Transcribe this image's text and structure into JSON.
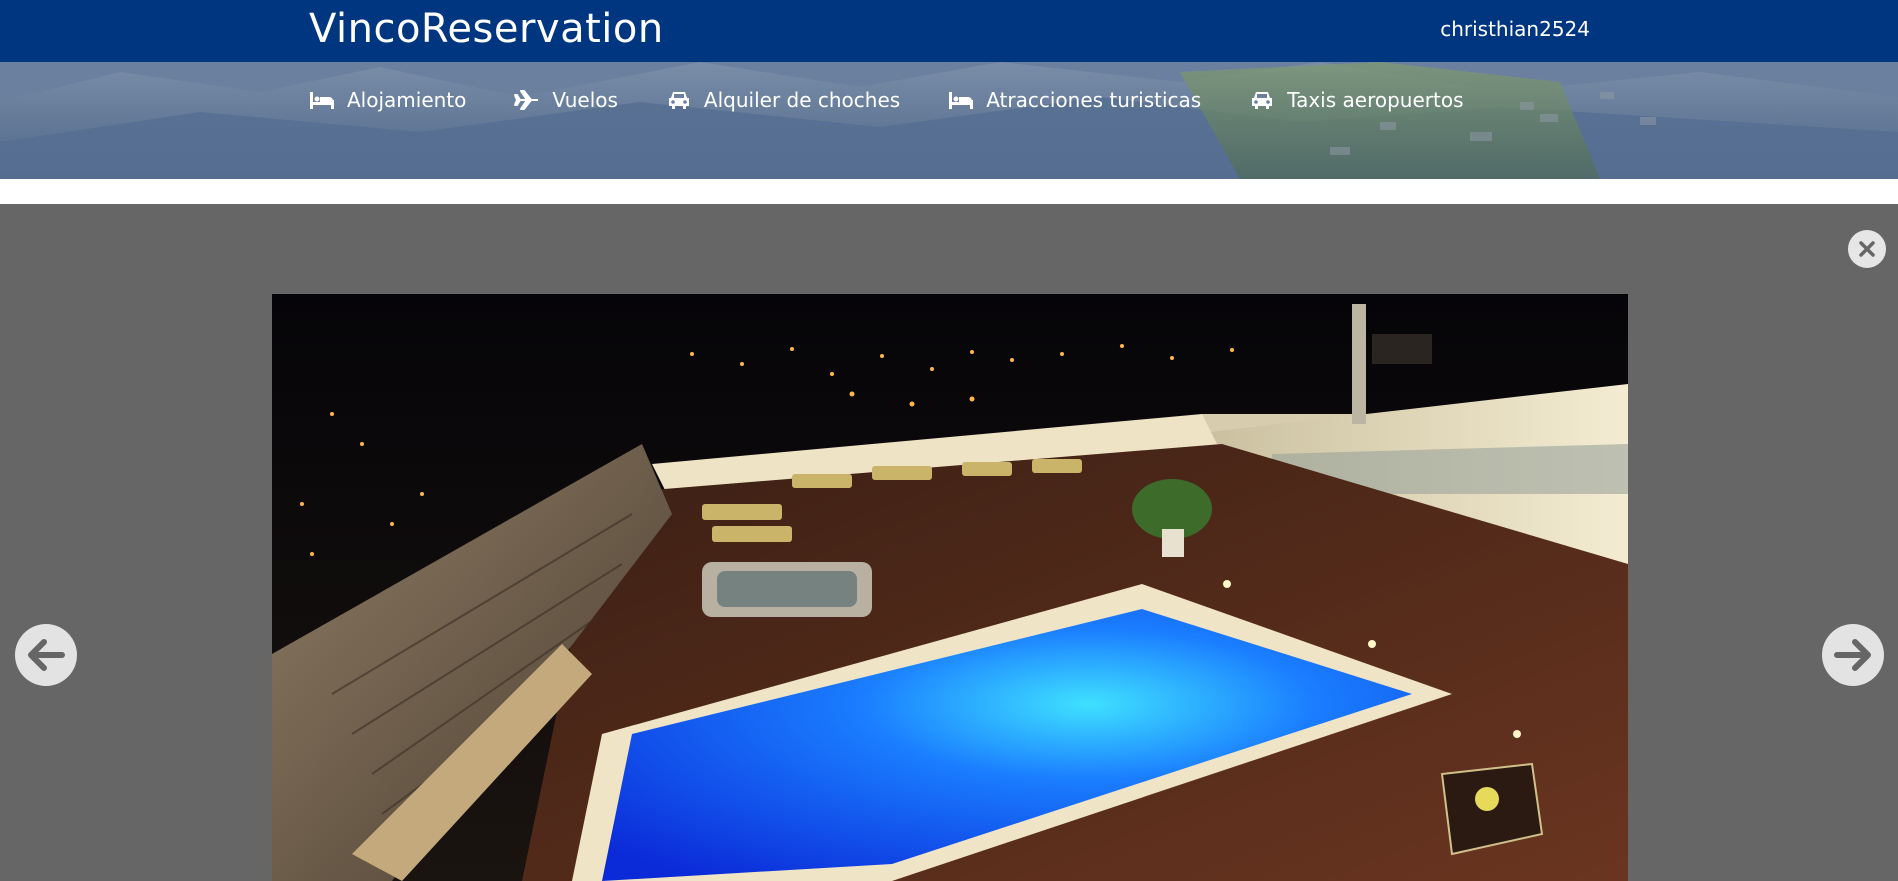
{
  "header": {
    "brand": "VincoReservation",
    "username": "christhian2524"
  },
  "nav": {
    "items": [
      {
        "label": "Alojamiento",
        "icon": "bed-icon"
      },
      {
        "label": "Vuelos",
        "icon": "plane-icon"
      },
      {
        "label": "Alquiler de choches",
        "icon": "car-icon"
      },
      {
        "label": "Atracciones turisticas",
        "icon": "bed-icon"
      },
      {
        "label": "Taxis aeropuertos",
        "icon": "car-icon"
      }
    ]
  },
  "lightbox": {
    "close_icon": "close-icon",
    "prev_icon": "arrow-left-icon",
    "next_icon": "arrow-right-icon",
    "image_subject": "hotel-rooftop-pool-night"
  },
  "colors": {
    "header_bg": "#003580",
    "overlay_bg": "#666666",
    "control_bg": "#e6e6e6"
  }
}
